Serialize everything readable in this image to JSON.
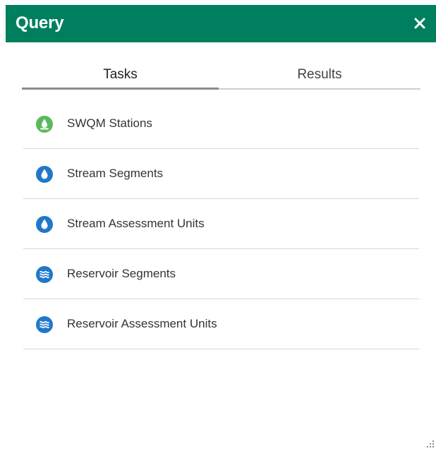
{
  "header": {
    "title": "Query",
    "close_icon": "close-icon",
    "background": "#007f5f"
  },
  "tabs": [
    {
      "label": "Tasks",
      "active": true
    },
    {
      "label": "Results",
      "active": false
    }
  ],
  "tasks": [
    {
      "label": "SWQM Stations",
      "icon": "station-drop-icon",
      "icon_color": "#5cb85c"
    },
    {
      "label": "Stream Segments",
      "icon": "water-drop-icon",
      "icon_color": "#1f78c8"
    },
    {
      "label": "Stream Assessment Units",
      "icon": "water-drop-icon",
      "icon_color": "#1f78c8"
    },
    {
      "label": "Reservoir Segments",
      "icon": "waves-icon",
      "icon_color": "#1f78c8"
    },
    {
      "label": "Reservoir Assessment Units",
      "icon": "waves-icon",
      "icon_color": "#1f78c8"
    }
  ]
}
